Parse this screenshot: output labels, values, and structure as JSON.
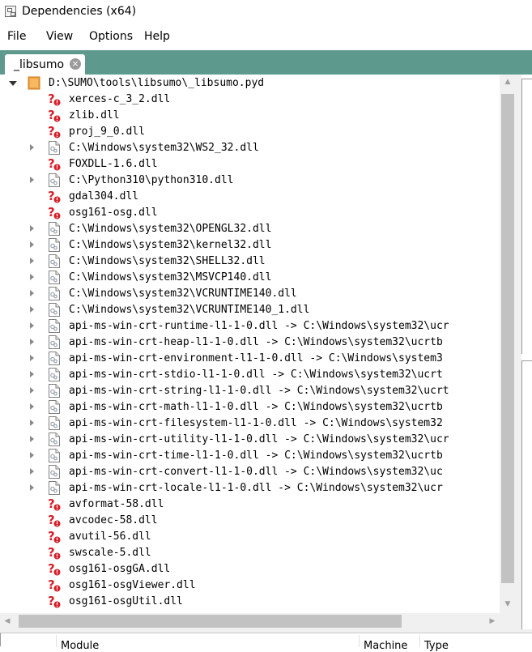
{
  "window": {
    "title": "Dependencies (x64)"
  },
  "menu": [
    "File",
    "View",
    "Options",
    "Help"
  ],
  "tab": {
    "label": "_libsumo",
    "close_glyph": "×"
  },
  "tree": {
    "root": {
      "label": "D:\\SUMO\\tools\\libsumo\\_libsumo.pyd",
      "icon": "folder-module-icon"
    },
    "items": [
      {
        "label": "xerces-c_3_2.dll",
        "icon": "missing-dll-icon",
        "expandable": false
      },
      {
        "label": "zlib.dll",
        "icon": "missing-dll-icon",
        "expandable": false
      },
      {
        "label": "proj_9_0.dll",
        "icon": "missing-dll-icon",
        "expandable": false
      },
      {
        "label": "C:\\Windows\\system32\\WS2_32.dll",
        "icon": "dll-file-icon",
        "expandable": true
      },
      {
        "label": "FOXDLL-1.6.dll",
        "icon": "missing-dll-icon",
        "expandable": false
      },
      {
        "label": "C:\\Python310\\python310.dll",
        "icon": "dll-file-icon",
        "expandable": true
      },
      {
        "label": "gdal304.dll",
        "icon": "missing-dll-icon",
        "expandable": false
      },
      {
        "label": "osg161-osg.dll",
        "icon": "missing-dll-icon",
        "expandable": false
      },
      {
        "label": "C:\\Windows\\system32\\OPENGL32.dll",
        "icon": "dll-file-icon",
        "expandable": true
      },
      {
        "label": "C:\\Windows\\system32\\kernel32.dll",
        "icon": "dll-file-icon",
        "expandable": true
      },
      {
        "label": "C:\\Windows\\system32\\SHELL32.dll",
        "icon": "dll-file-icon",
        "expandable": true
      },
      {
        "label": "C:\\Windows\\system32\\MSVCP140.dll",
        "icon": "dll-file-icon",
        "expandable": true
      },
      {
        "label": "C:\\Windows\\system32\\VCRUNTIME140.dll",
        "icon": "dll-file-icon",
        "expandable": true
      },
      {
        "label": "C:\\Windows\\system32\\VCRUNTIME140_1.dll",
        "icon": "dll-file-icon",
        "expandable": true
      },
      {
        "label": "api-ms-win-crt-runtime-l1-1-0.dll -> C:\\Windows\\system32\\ucr",
        "icon": "dll-file-icon",
        "expandable": true
      },
      {
        "label": "api-ms-win-crt-heap-l1-1-0.dll -> C:\\Windows\\system32\\ucrtb",
        "icon": "dll-file-icon",
        "expandable": true
      },
      {
        "label": "api-ms-win-crt-environment-l1-1-0.dll -> C:\\Windows\\system3",
        "icon": "dll-file-icon",
        "expandable": true
      },
      {
        "label": "api-ms-win-crt-stdio-l1-1-0.dll -> C:\\Windows\\system32\\ucrt",
        "icon": "dll-file-icon",
        "expandable": true
      },
      {
        "label": "api-ms-win-crt-string-l1-1-0.dll -> C:\\Windows\\system32\\ucrt",
        "icon": "dll-file-icon",
        "expandable": true
      },
      {
        "label": "api-ms-win-crt-math-l1-1-0.dll -> C:\\Windows\\system32\\ucrtb",
        "icon": "dll-file-icon",
        "expandable": true
      },
      {
        "label": "api-ms-win-crt-filesystem-l1-1-0.dll -> C:\\Windows\\system32",
        "icon": "dll-file-icon",
        "expandable": true
      },
      {
        "label": "api-ms-win-crt-utility-l1-1-0.dll -> C:\\Windows\\system32\\ucr",
        "icon": "dll-file-icon",
        "expandable": true
      },
      {
        "label": "api-ms-win-crt-time-l1-1-0.dll -> C:\\Windows\\system32\\ucrtb",
        "icon": "dll-file-icon",
        "expandable": true
      },
      {
        "label": "api-ms-win-crt-convert-l1-1-0.dll -> C:\\Windows\\system32\\uc",
        "icon": "dll-file-icon",
        "expandable": true
      },
      {
        "label": "api-ms-win-crt-locale-l1-1-0.dll -> C:\\Windows\\system32\\ucr",
        "icon": "dll-file-icon",
        "expandable": true
      },
      {
        "label": "avformat-58.dll",
        "icon": "missing-dll-icon",
        "expandable": false
      },
      {
        "label": "avcodec-58.dll",
        "icon": "missing-dll-icon",
        "expandable": false
      },
      {
        "label": "avutil-56.dll",
        "icon": "missing-dll-icon",
        "expandable": false
      },
      {
        "label": "swscale-5.dll",
        "icon": "missing-dll-icon",
        "expandable": false
      },
      {
        "label": "osg161-osgGA.dll",
        "icon": "missing-dll-icon",
        "expandable": false
      },
      {
        "label": "osg161-osgViewer.dll",
        "icon": "missing-dll-icon",
        "expandable": false
      },
      {
        "label": "osg161-osgUtil.dll",
        "icon": "missing-dll-icon",
        "expandable": false
      }
    ]
  },
  "bottom_grid": {
    "columns": [
      "Module",
      "Machine",
      "Type"
    ]
  },
  "colors": {
    "tab_strip": "#5e998e",
    "missing_icon": "#d6202a"
  }
}
